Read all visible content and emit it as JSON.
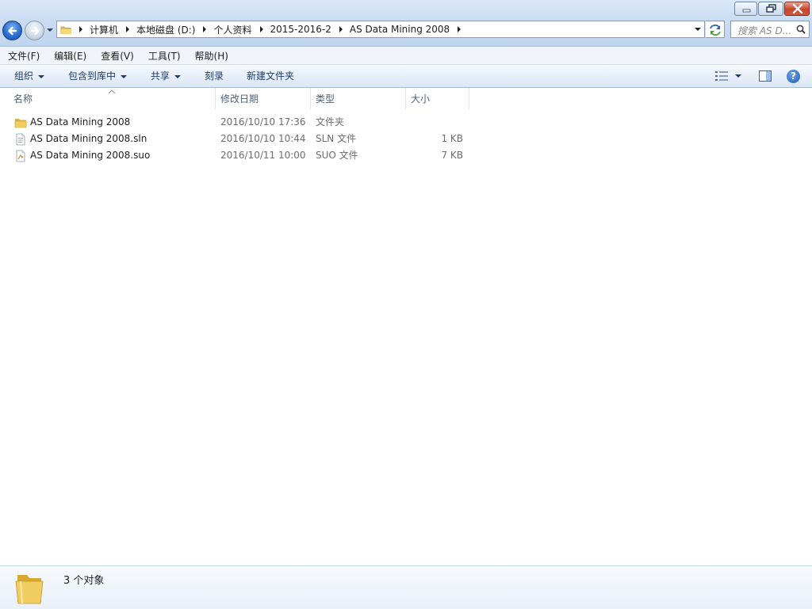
{
  "address": {
    "crumbs": [
      "计算机",
      "本地磁盘 (D:)",
      "个人资料",
      "2015-2016-2",
      "AS Data Mining 2008"
    ]
  },
  "search": {
    "placeholder": "搜索 AS D..."
  },
  "menu": [
    "文件(F)",
    "编辑(E)",
    "查看(V)",
    "工具(T)",
    "帮助(H)"
  ],
  "commands": {
    "organize": "组织",
    "include_library": "包含到库中",
    "share": "共享",
    "burn": "刻录",
    "new_folder": "新建文件夹"
  },
  "columns": {
    "name": "名称",
    "modified": "修改日期",
    "type": "类型",
    "size": "大小"
  },
  "files": [
    {
      "name": "AS Data Mining 2008",
      "modified": "2016/10/10 17:36",
      "type": "文件夹",
      "size": "",
      "icon": "folder-icon"
    },
    {
      "name": "AS Data Mining 2008.sln",
      "modified": "2016/10/10 10:44",
      "type": "SLN 文件",
      "size": "1 KB",
      "icon": "sln-file-icon"
    },
    {
      "name": "AS Data Mining 2008.suo",
      "modified": "2016/10/11 10:00",
      "type": "SUO 文件",
      "size": "7 KB",
      "icon": "suo-file-icon"
    }
  ],
  "status": {
    "count": "3 个对象"
  },
  "help_glyph": "?",
  "colors": {
    "accent": "#2a6fd1",
    "close": "#c8432b",
    "command_text": "#1e3c64"
  }
}
